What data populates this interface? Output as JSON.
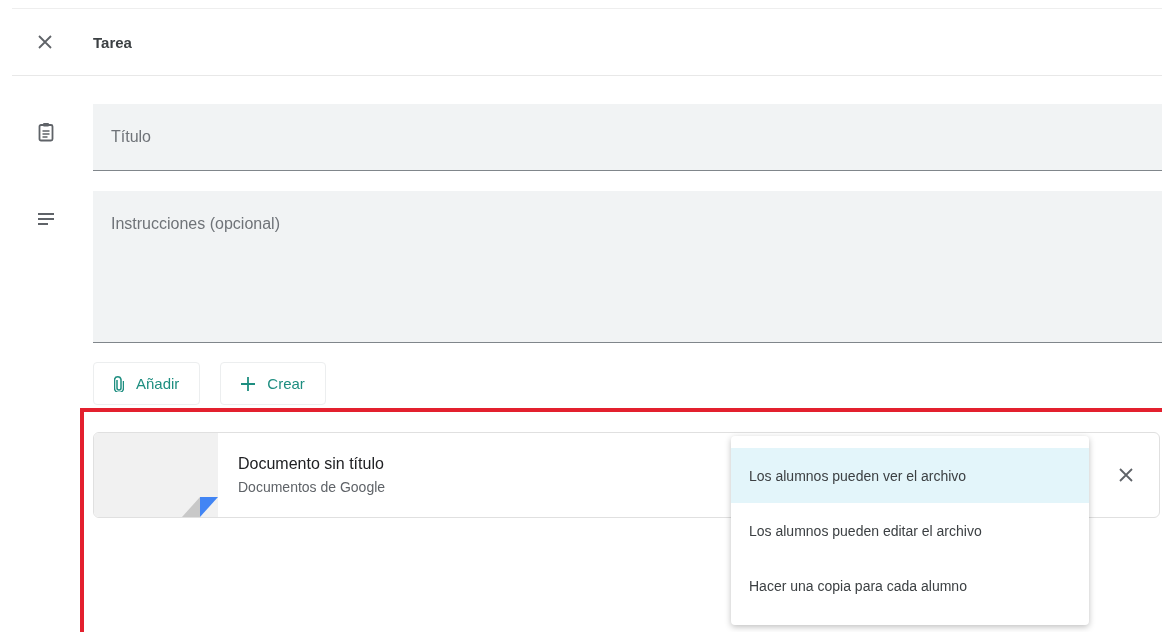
{
  "header": {
    "title": "Tarea"
  },
  "fields": [
    {
      "kind": "title",
      "placeholder": "Título"
    },
    {
      "kind": "instructions",
      "placeholder": "Instrucciones (opcional)"
    }
  ],
  "actions": [
    {
      "kind": "attach",
      "label": "Añadir"
    },
    {
      "kind": "create",
      "label": "Crear"
    }
  ],
  "attachment": {
    "name": "Documento sin título",
    "type": "Documentos de Google"
  },
  "share_menu": [
    {
      "label": "Los alumnos pueden ver el archivo",
      "selected": true
    },
    {
      "label": "Los alumnos pueden editar el archivo",
      "selected": false
    },
    {
      "label": "Hacer una copia para cada alumno",
      "selected": false
    }
  ]
}
